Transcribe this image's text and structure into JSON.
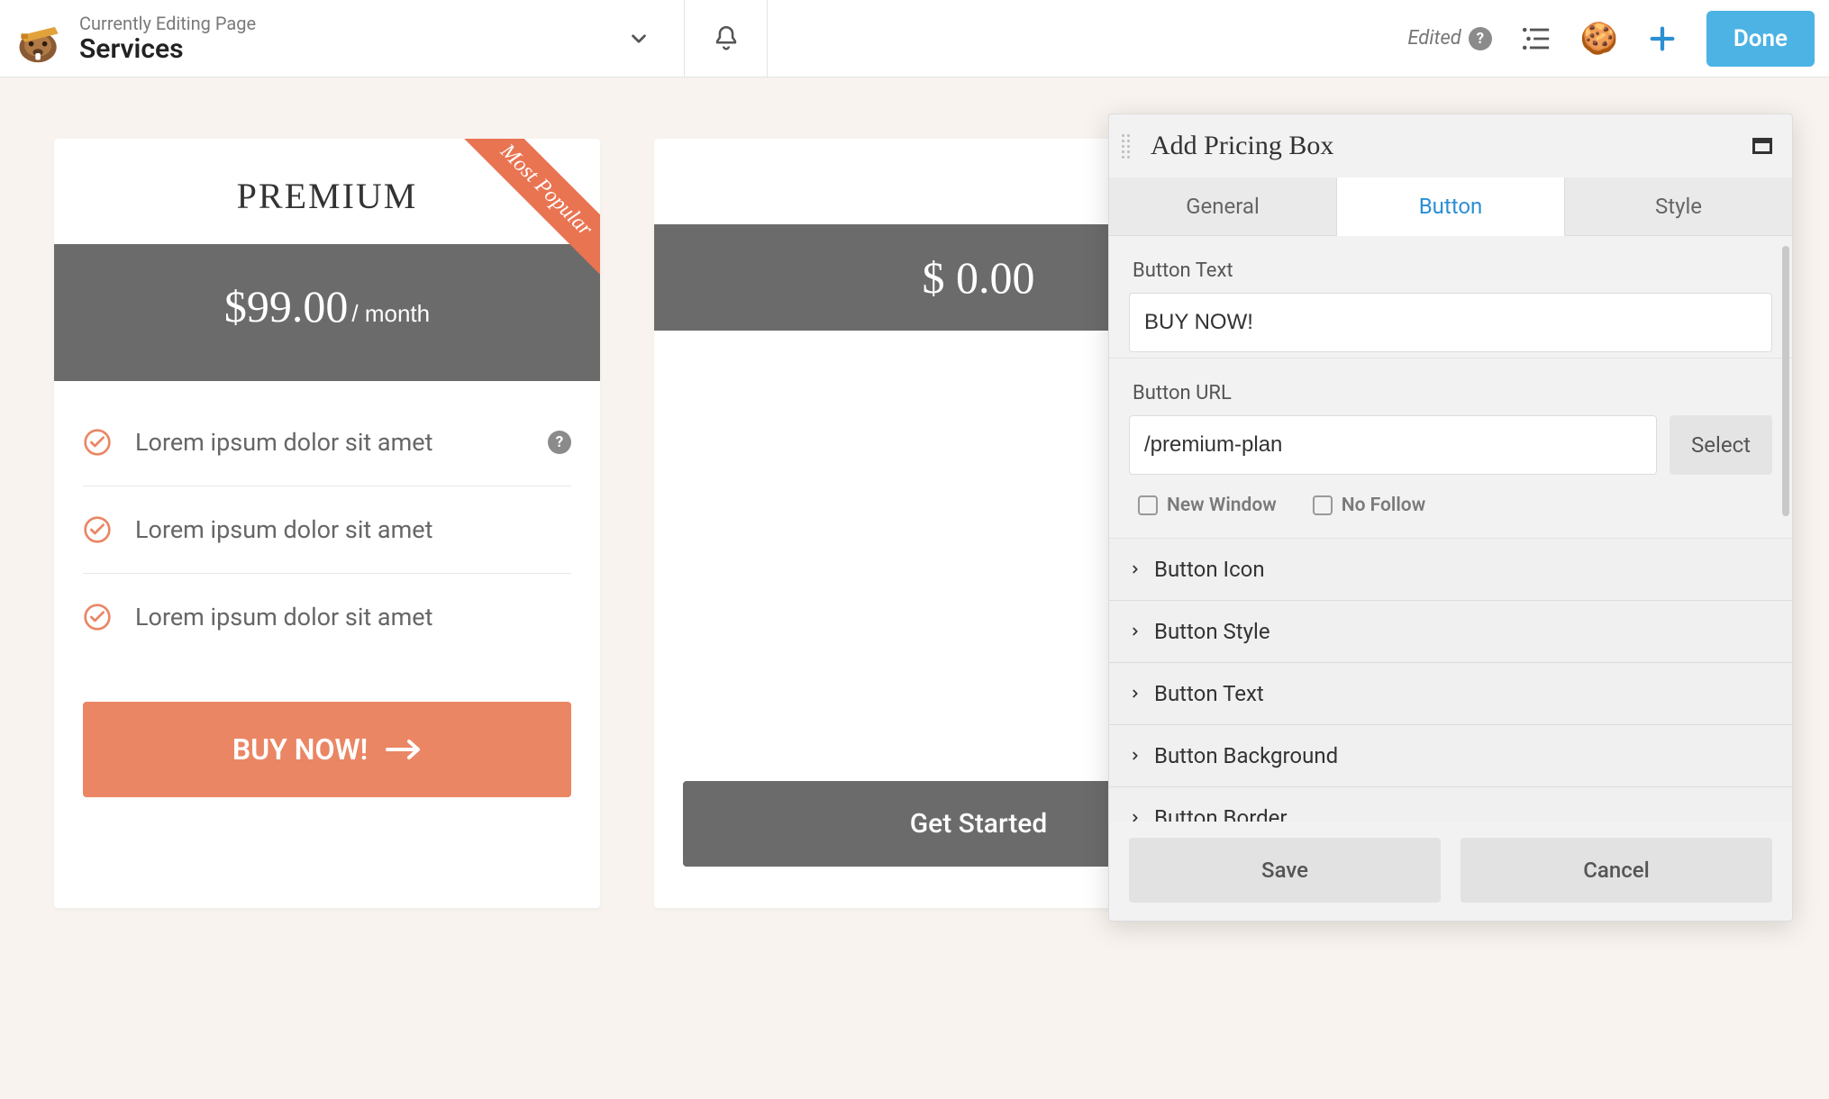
{
  "topbar": {
    "editing_label": "Currently Editing Page",
    "page_title": "Services",
    "edited_label": "Edited",
    "done_label": "Done"
  },
  "pricing_cards": [
    {
      "title": "PREMIUM",
      "ribbon": "Most Popular",
      "price": "$99.00",
      "period": "/ month",
      "features": [
        "Lorem ipsum dolor sit amet",
        "Lorem ipsum dolor sit amet",
        "Lorem ipsum dolor sit amet"
      ],
      "cta_label": "BUY NOW!"
    },
    {
      "price": "$ 0.00",
      "cta_label": "Get Started"
    }
  ],
  "panel": {
    "title": "Add Pricing Box",
    "tabs": {
      "general": "General",
      "button": "Button",
      "style": "Style"
    },
    "fields": {
      "button_text_label": "Button Text",
      "button_text_value": "BUY NOW!",
      "button_url_label": "Button URL",
      "button_url_value": "/premium-plan",
      "select_label": "Select",
      "new_window_label": "New Window",
      "no_follow_label": "No Follow"
    },
    "accordion": {
      "icon": "Button Icon",
      "style": "Button Style",
      "text": "Button Text",
      "background": "Button Background",
      "border": "Button Border"
    },
    "footer": {
      "save": "Save",
      "cancel": "Cancel"
    }
  }
}
